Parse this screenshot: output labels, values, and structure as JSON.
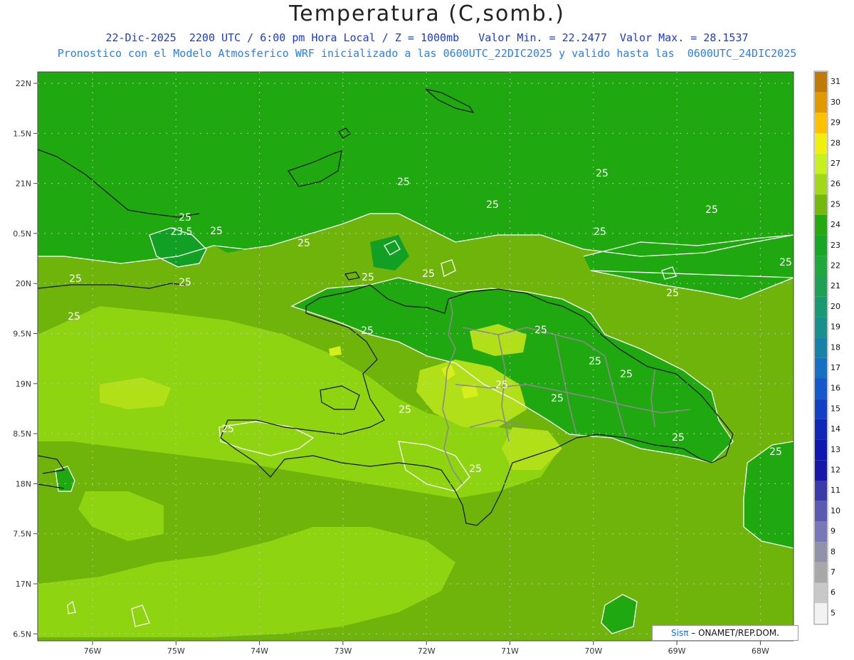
{
  "header": {
    "title": "Temperatura (C,somb.)",
    "line1": "22-Dic-2025  2200 UTC / 6:00 pm Hora Local / Z = 1000mb   Valor Min. = 22.2477  Valor Max. = 28.1537",
    "line2": "Pronostico con el Modelo Atmosferico WRF inicializado a las 0600UTC_22DIC2025 y valido hasta las  0600UTC_24DIC2025"
  },
  "map": {
    "lat_labels": [
      "22N",
      "1.5N",
      "21N",
      "0.5N",
      "20N",
      "9.5N",
      "19N",
      "8.5N",
      "18N",
      "7.5N",
      "17N",
      "6.5N"
    ],
    "lon_labels": [
      "76W",
      "75W",
      "74W",
      "73W",
      "72W",
      "71W",
      "70W",
      "69W",
      "68W"
    ],
    "contour_labels": [
      {
        "text": "25"
      },
      {
        "text": "25"
      },
      {
        "text": "23.5"
      },
      {
        "text": "25"
      },
      {
        "text": "25"
      },
      {
        "text": "25"
      },
      {
        "text": "25"
      },
      {
        "text": "25"
      },
      {
        "text": "25"
      },
      {
        "text": "25"
      },
      {
        "text": "25"
      },
      {
        "text": "25"
      },
      {
        "text": "25"
      },
      {
        "text": "25"
      },
      {
        "text": "25"
      },
      {
        "text": "25"
      },
      {
        "text": "25"
      },
      {
        "text": "25"
      },
      {
        "text": "25"
      },
      {
        "text": "25"
      },
      {
        "text": "25"
      },
      {
        "text": "25"
      },
      {
        "text": "25"
      },
      {
        "text": "25"
      },
      {
        "text": "25"
      },
      {
        "text": "25"
      },
      {
        "text": "25"
      }
    ],
    "colors": {
      "ocean_base": "#6fb40a",
      "band_24": "#1fa80f",
      "band_23": "#12a024",
      "band_25_5": "#8fd410",
      "band_26": "#b2e018",
      "band_26_5": "#d6ee1a",
      "coast": "#111111",
      "borders": "#8a8a8a",
      "contour": "#ffffff"
    }
  },
  "colorbar": {
    "labels": [
      "31",
      "30",
      "29",
      "28",
      "27",
      "26",
      "25",
      "24",
      "23",
      "22",
      "21",
      "20",
      "19",
      "18",
      "17",
      "16",
      "15",
      "14",
      "13",
      "12",
      "11",
      "10",
      "9",
      "8",
      "7",
      "6",
      "5"
    ],
    "colors": [
      "#c07a08",
      "#e09a00",
      "#ffc000",
      "#f0f010",
      "#c8f020",
      "#a2d81a",
      "#74b80e",
      "#24aa10",
      "#18a626",
      "#20a83c",
      "#1ea055",
      "#1a9a72",
      "#18908e",
      "#1682a8",
      "#1570c4",
      "#1458cc",
      "#1240c4",
      "#1028b8",
      "#0c18b0",
      "#1616a8",
      "#3a3aa8",
      "#5a5ab0",
      "#7878b8",
      "#9090a8",
      "#a8a8a8",
      "#c8c8c8",
      "#f2f2f2"
    ]
  },
  "credit": {
    "brand": "Sisπ",
    "text": " – ONAMET/REP.DOM."
  }
}
